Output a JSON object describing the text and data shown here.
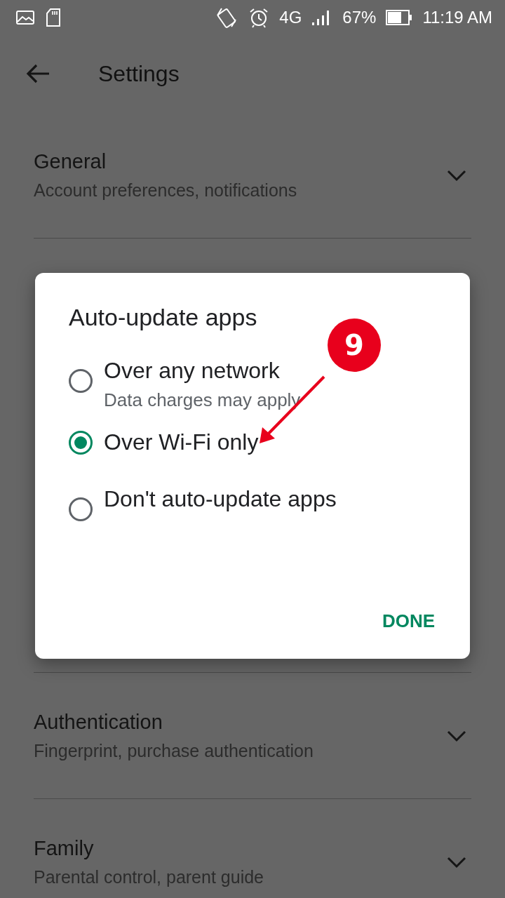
{
  "status_bar": {
    "network": "4G",
    "battery": "67%",
    "time": "11:19 AM"
  },
  "app_bar": {
    "title": "Settings"
  },
  "sections_top": [
    {
      "title": "General",
      "subtitle": "Account preferences, notifications",
      "expanded": false
    }
  ],
  "sections_bottom": [
    {
      "title": "Authentication",
      "subtitle": "Fingerprint, purchase authentication",
      "expanded": false
    },
    {
      "title": "Family",
      "subtitle": "Parental control, parent guide",
      "expanded": false
    }
  ],
  "dialog": {
    "title": "Auto-update apps",
    "options": [
      {
        "label": "Over any network",
        "hint": "Data charges may apply",
        "selected": false
      },
      {
        "label": "Over Wi-Fi only",
        "selected": true
      },
      {
        "label": "Don't auto-update apps",
        "selected": false
      }
    ],
    "button": "DONE"
  },
  "annotation": {
    "label": "9"
  }
}
